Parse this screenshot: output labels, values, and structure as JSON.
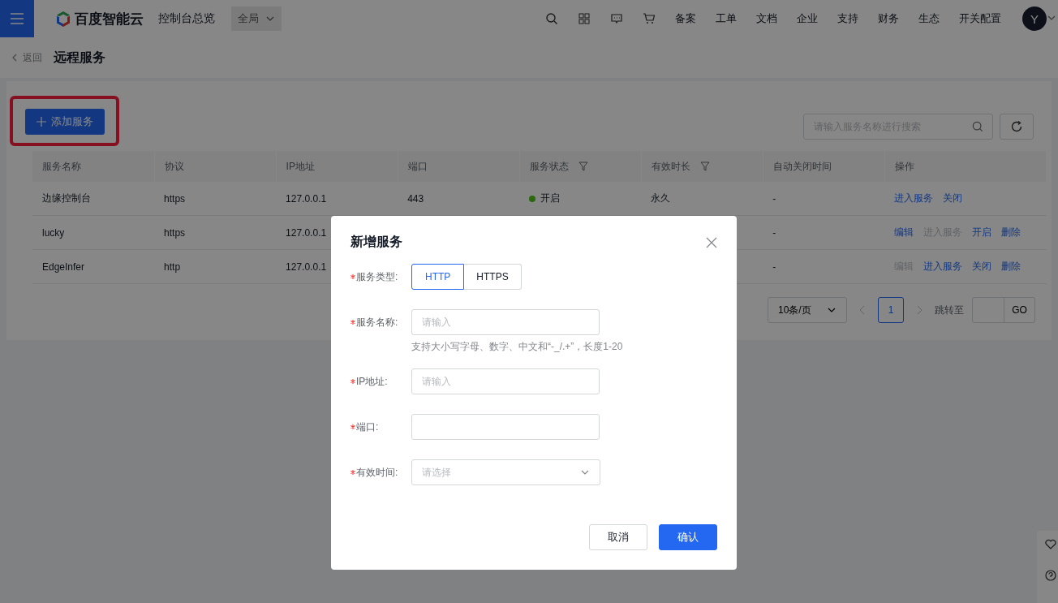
{
  "nav": {
    "brand": "百度智能云",
    "title": "控制台总览",
    "scope": "全局",
    "links": [
      "备案",
      "工单",
      "文档",
      "企业",
      "支持",
      "财务",
      "生态",
      "开关配置"
    ],
    "avatar": "Y"
  },
  "header": {
    "back": "返回",
    "title": "远程服务"
  },
  "toolbar": {
    "add_button": "添加服务",
    "highlighted": true,
    "search": {
      "placeholder": "请输入服务名称进行搜索"
    }
  },
  "table": {
    "columns": [
      {
        "label": "服务名称",
        "filter": false
      },
      {
        "label": "协议",
        "filter": false
      },
      {
        "label": "IP地址",
        "filter": false
      },
      {
        "label": "端口",
        "filter": false
      },
      {
        "label": "服务状态",
        "filter": true
      },
      {
        "label": "有效时长",
        "filter": true
      },
      {
        "label": "自动关闭时间",
        "filter": false
      },
      {
        "label": "操作",
        "filter": false
      }
    ],
    "rows": [
      {
        "name": "边缘控制台",
        "protocol": "https",
        "ip": "127.0.0.1",
        "port": "443",
        "status": {
          "label": "开启",
          "on": true
        },
        "duration": "永久",
        "auto_close": "-",
        "actions": [
          {
            "label": "进入服务",
            "disabled": false
          },
          {
            "label": "关闭",
            "disabled": false
          }
        ]
      },
      {
        "name": "lucky",
        "protocol": "https",
        "ip": "127.0.0.1",
        "auto_close": "-",
        "actions": [
          {
            "label": "编辑",
            "disabled": false
          },
          {
            "label": "进入服务",
            "disabled": true
          },
          {
            "label": "开启",
            "disabled": false
          },
          {
            "label": "删除",
            "disabled": false
          }
        ]
      },
      {
        "name": "EdgeInfer",
        "protocol": "http",
        "ip": "127.0.0.1",
        "auto_close": "-",
        "actions": [
          {
            "label": "编辑",
            "disabled": true
          },
          {
            "label": "进入服务",
            "disabled": false
          },
          {
            "label": "关闭",
            "disabled": false
          },
          {
            "label": "删除",
            "disabled": false
          }
        ]
      }
    ]
  },
  "pagination": {
    "page_size": "10条/页",
    "pages": [
      {
        "label": "1",
        "selected": true
      }
    ],
    "jump_label": "跳转至",
    "go": "GO"
  },
  "dialog": {
    "title": "新增服务",
    "fields": [
      {
        "kind": "segmented",
        "label": "服务类型:",
        "required": true,
        "options": [
          {
            "label": "HTTP",
            "selected": true
          },
          {
            "label": "HTTPS",
            "selected": false
          }
        ]
      },
      {
        "kind": "input",
        "label": "服务名称:",
        "required": true,
        "placeholder": "请输入",
        "hint": "支持大小写字母、数字、中文和“-_/.+”，长度1-20"
      },
      {
        "kind": "input",
        "label": "IP地址:",
        "required": true,
        "placeholder": "请输入"
      },
      {
        "kind": "input",
        "label": "端口:",
        "required": true
      },
      {
        "kind": "select",
        "label": "有效时间:",
        "required": true,
        "placeholder": "请选择"
      }
    ],
    "buttons": [
      {
        "label": "取消",
        "kind": "secondary"
      },
      {
        "label": "确认",
        "kind": "primary"
      }
    ]
  }
}
